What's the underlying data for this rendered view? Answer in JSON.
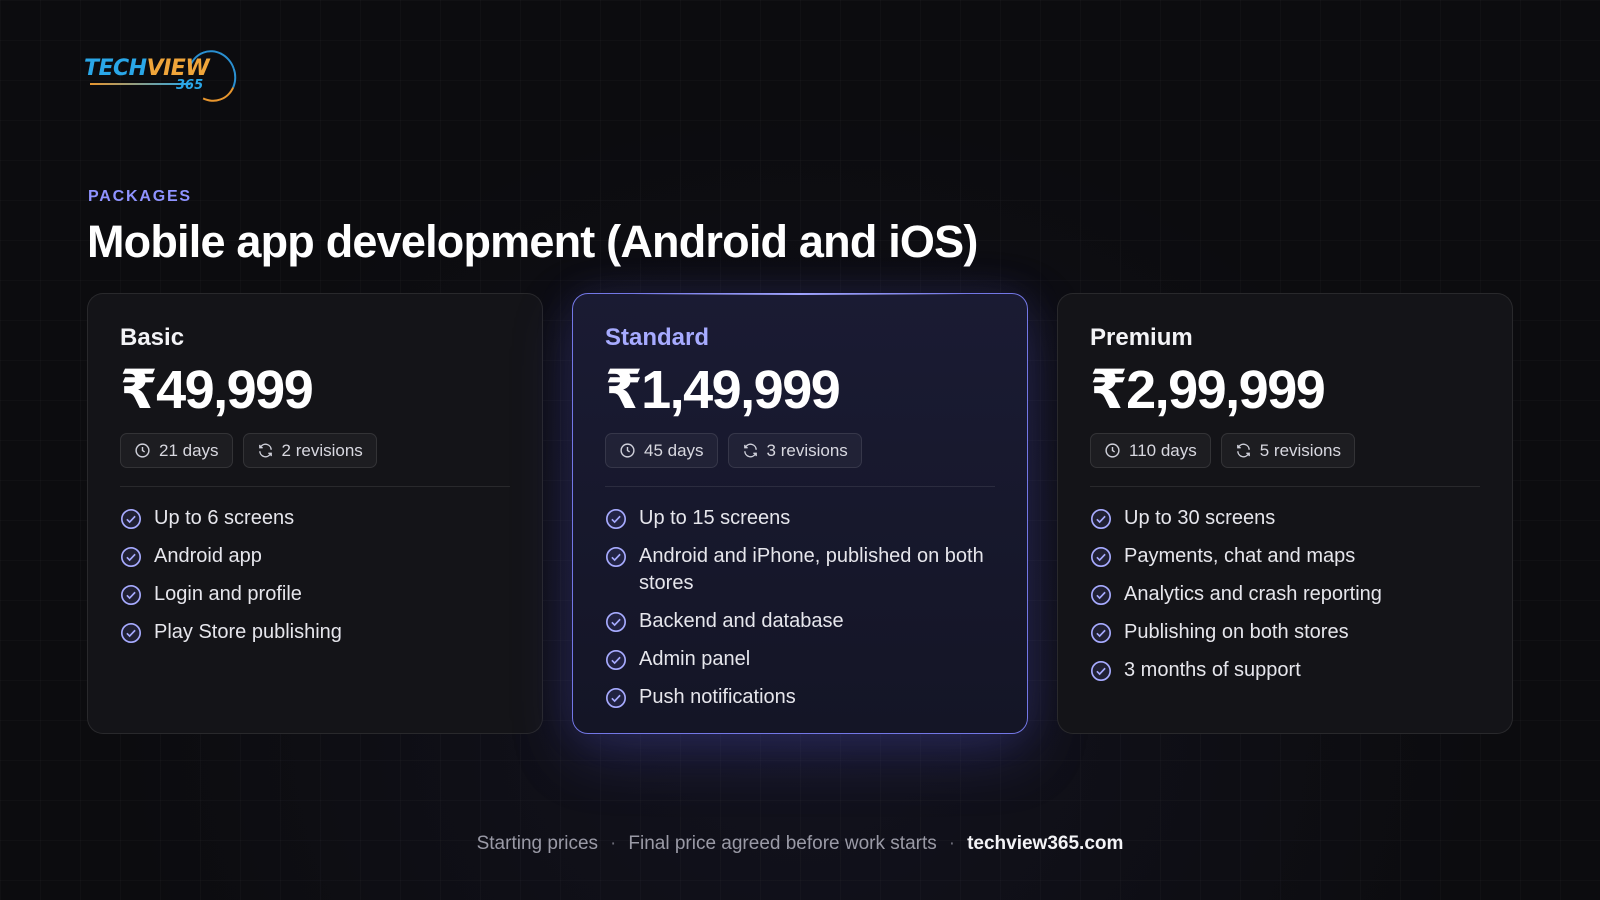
{
  "logo": {
    "text_part1": "TECH",
    "text_part2": "VIEW",
    "text_part3": "365"
  },
  "header": {
    "eyebrow": "PACKAGES",
    "title": "Mobile app development (Android and iOS)"
  },
  "plans": [
    {
      "name": "Basic",
      "price": "₹49,999",
      "duration": "21 days",
      "revisions": "2 revisions",
      "features": [
        "Up to 6 screens",
        "Android app",
        "Login and profile",
        "Play Store publishing"
      ]
    },
    {
      "name": "Standard",
      "price": "₹1,49,999",
      "duration": "45 days",
      "revisions": "3 revisions",
      "features": [
        "Up to 15 screens",
        "Android and iPhone, published on both stores",
        "Backend and database",
        "Admin panel",
        "Push notifications"
      ]
    },
    {
      "name": "Premium",
      "price": "₹2,99,999",
      "duration": "110 days",
      "revisions": "5 revisions",
      "features": [
        "Up to 30 screens",
        "Payments, chat and maps",
        "Analytics and crash reporting",
        "Publishing on both stores",
        "3 months of support"
      ]
    }
  ],
  "footer": {
    "note1": "Starting prices",
    "separator": "·",
    "note2": "Final price agreed before work starts",
    "site": "techview365.com"
  },
  "colors": {
    "accent": "#8f93ff",
    "background": "#0c0c0f",
    "featured_border": "#7377e6"
  },
  "icons": {
    "duration": "clock-icon",
    "revisions": "refresh-icon",
    "feature": "check-circle-icon"
  }
}
